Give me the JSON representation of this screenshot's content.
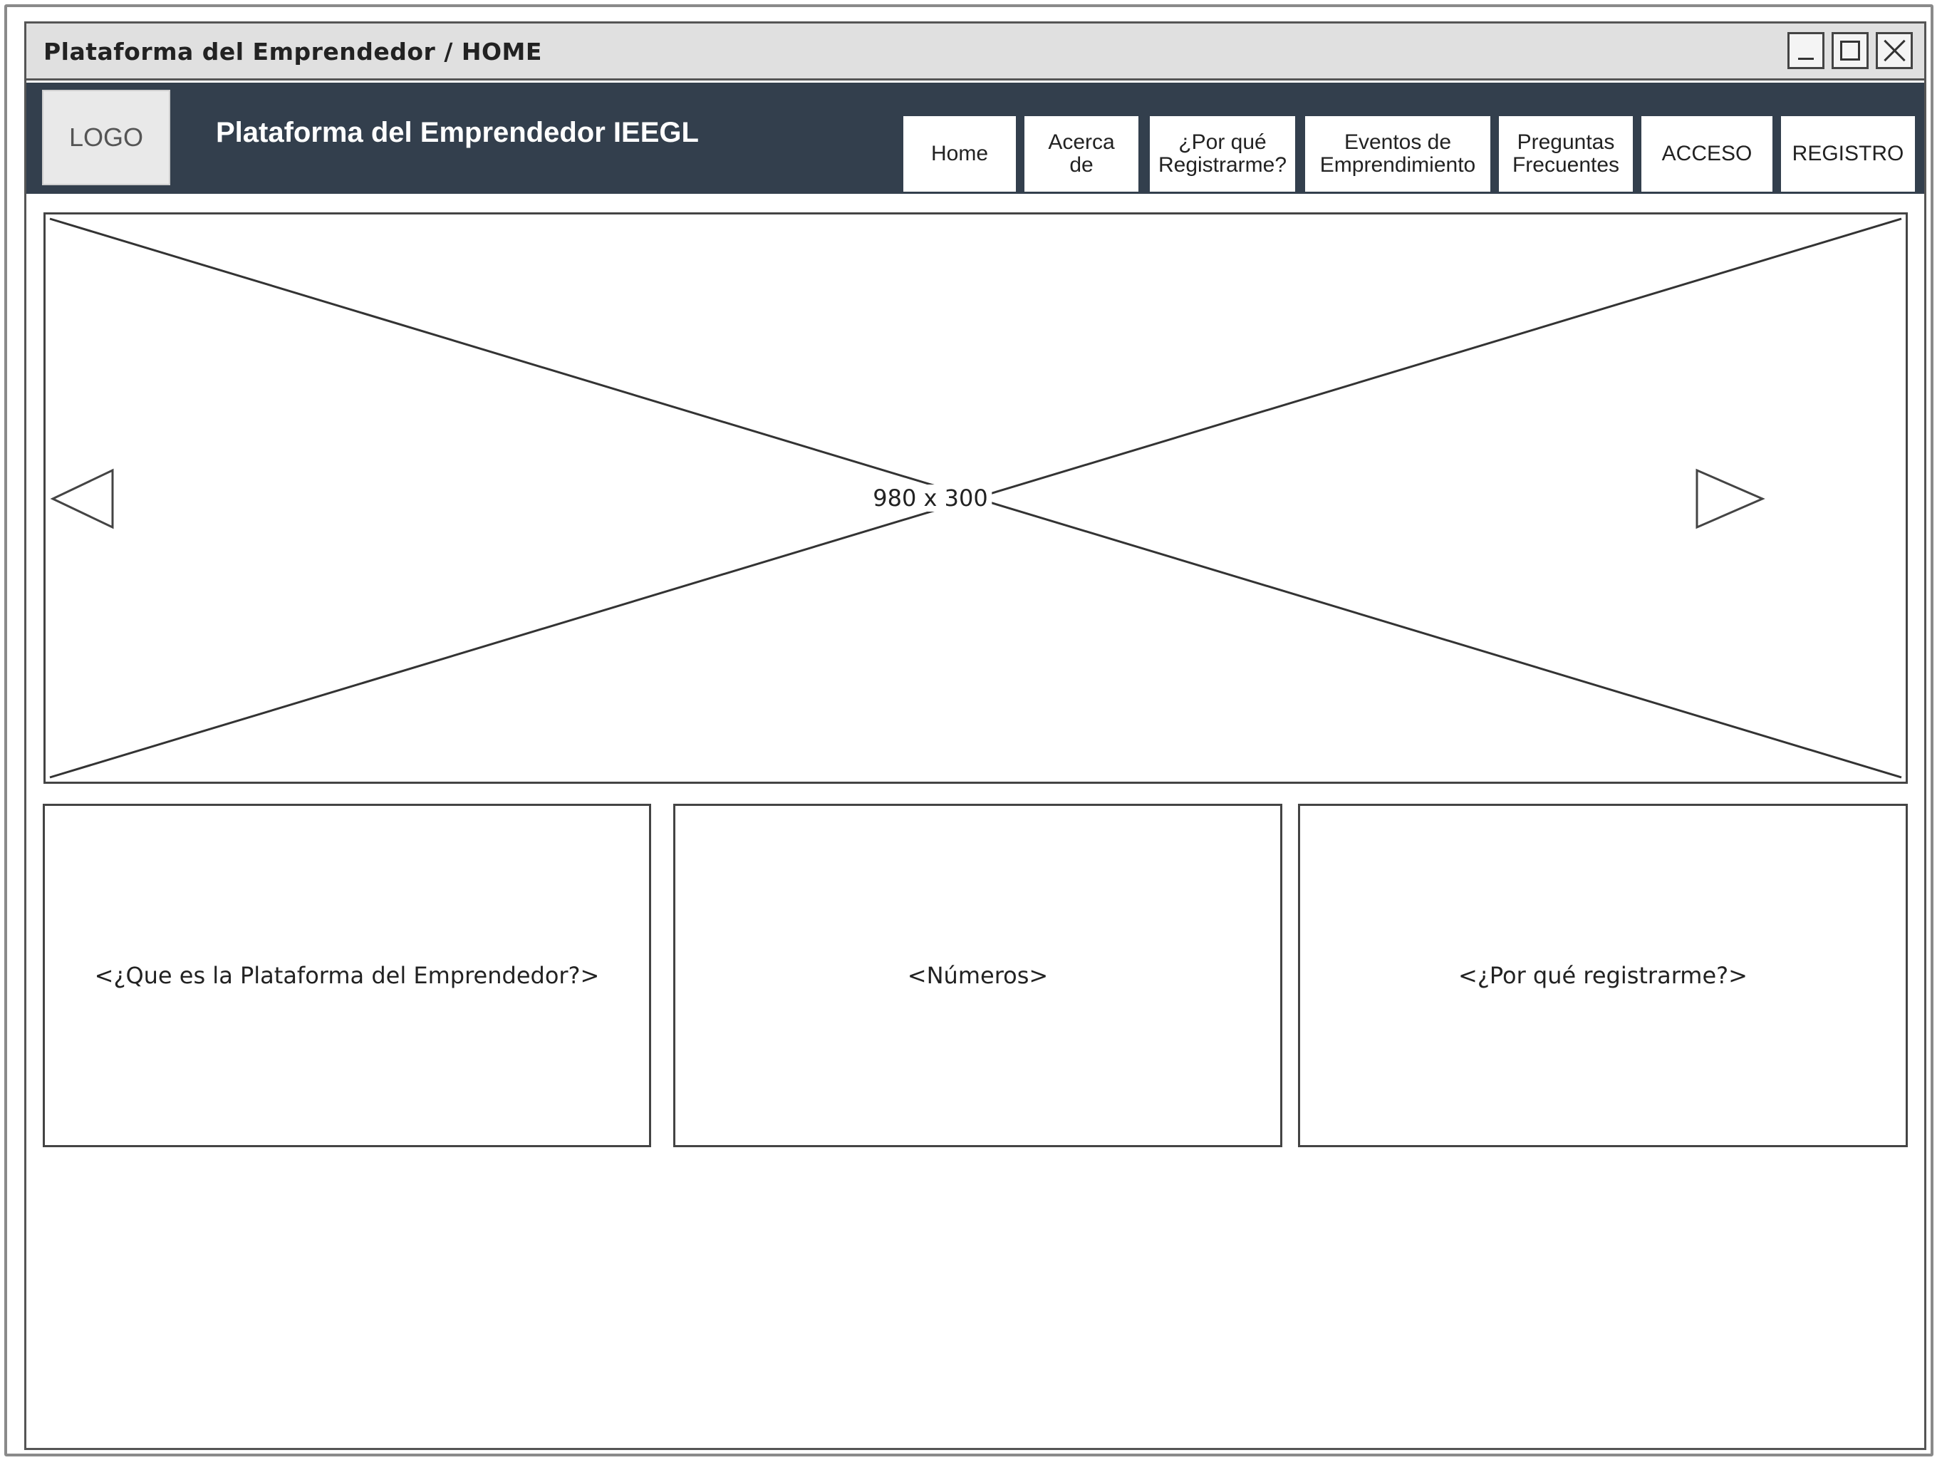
{
  "window": {
    "title": "Plataforma del Emprendedor / HOME"
  },
  "header": {
    "logo": "LOGO",
    "site_title": "Plataforma del Emprendedor IEEGL",
    "background_color": "#333f4d"
  },
  "nav": {
    "tabs": [
      {
        "label": "Home"
      },
      {
        "label": "Acerca\nde"
      },
      {
        "label": "¿Por qué\nRegistrarme?"
      },
      {
        "label": "Eventos de\nEmprendimiento"
      },
      {
        "label": "Preguntas\nFrecuentes"
      },
      {
        "label": "ACCESO"
      },
      {
        "label": "REGISTRO"
      }
    ]
  },
  "hero": {
    "placeholder_size": "980 x 300",
    "prev_icon": "triangle-left-icon",
    "next_icon": "triangle-right-icon"
  },
  "content": {
    "boxes": [
      {
        "label": "<¿Que es la Plataforma del Emprendedor?>"
      },
      {
        "label": "<Números>"
      },
      {
        "label": "<¿Por qué registrarme?>"
      }
    ]
  },
  "window_controls": {
    "minimize_icon": "minimize-icon",
    "maximize_icon": "maximize-icon",
    "close_icon": "close-icon"
  }
}
